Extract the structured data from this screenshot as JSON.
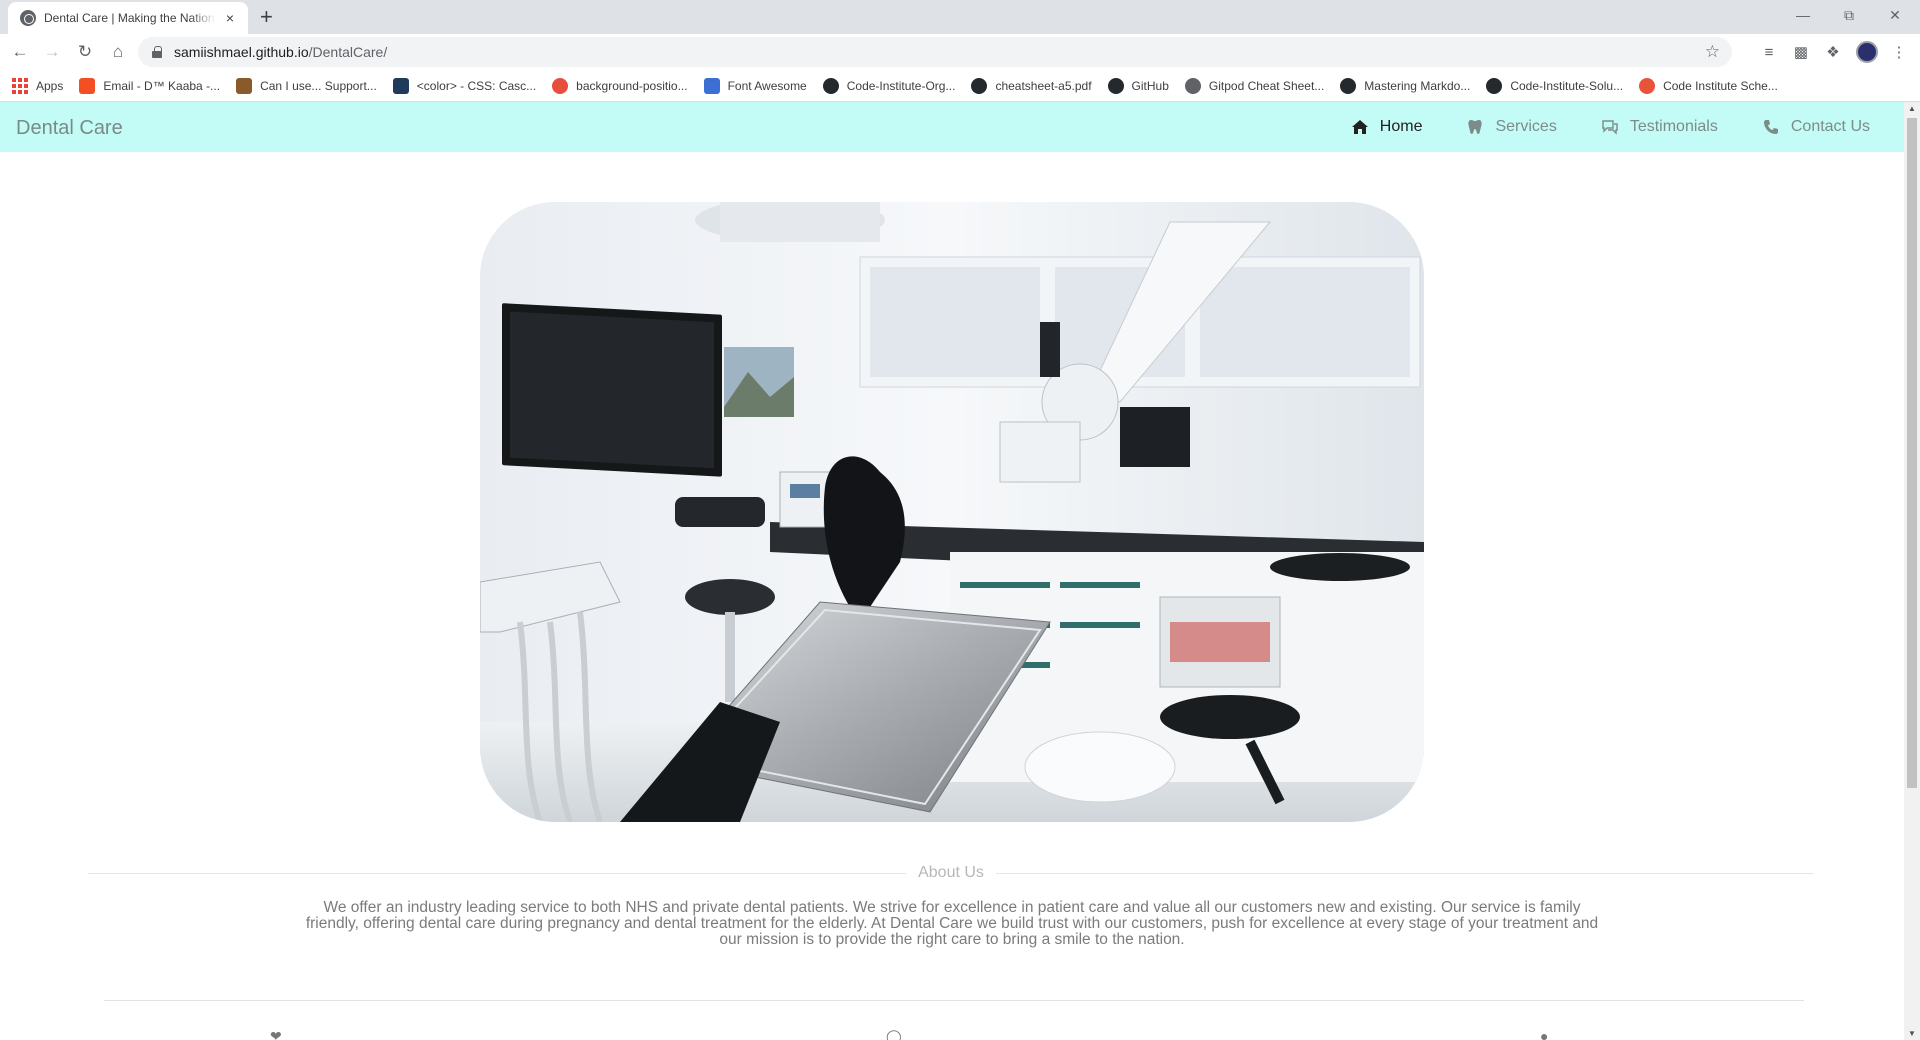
{
  "browser": {
    "tab_title": "Dental Care | Making the Nation",
    "tab_close": "×",
    "new_tab": "+",
    "url_host": "samiishmael.github.io",
    "url_path": "/DentalCare/",
    "bookmarks": [
      {
        "label": "Apps",
        "icon": "apps-grid",
        "color": "#ea4335"
      },
      {
        "label": "Email - D™ Kaaba -...",
        "icon": "office-icon",
        "color": "#f25022"
      },
      {
        "label": "Can I use... Support...",
        "icon": "caniuse-icon",
        "color": "#8b5a2b"
      },
      {
        "label": "<color> - CSS: Casc...",
        "icon": "mdn-icon",
        "color": "#1f3a5a"
      },
      {
        "label": "background-positio...",
        "icon": "css-icon",
        "color": "#e84e3d"
      },
      {
        "label": "Font Awesome",
        "icon": "flag-icon",
        "color": "#3b6fd4"
      },
      {
        "label": "Code-Institute-Org...",
        "icon": "github-icon",
        "color": "#24292e"
      },
      {
        "label": "cheatsheet-a5.pdf",
        "icon": "github-icon",
        "color": "#24292e"
      },
      {
        "label": "GitHub",
        "icon": "github-icon",
        "color": "#24292e"
      },
      {
        "label": "Gitpod Cheat Sheet...",
        "icon": "globe-icon",
        "color": "#5f6368"
      },
      {
        "label": "Mastering Markdo...",
        "icon": "github-icon",
        "color": "#24292e"
      },
      {
        "label": "Code-Institute-Solu...",
        "icon": "github-icon",
        "color": "#24292e"
      },
      {
        "label": "Code Institute Sche...",
        "icon": "ci-icon",
        "color": "#e8543a"
      }
    ]
  },
  "site": {
    "brand": "Dental Care",
    "nav": [
      {
        "label": "Home",
        "icon": "home-icon",
        "active": true
      },
      {
        "label": "Services",
        "icon": "tooth-icon",
        "active": false
      },
      {
        "label": "Testimonials",
        "icon": "comments-icon",
        "active": false
      },
      {
        "label": "Contact Us",
        "icon": "phone-icon",
        "active": false
      }
    ],
    "about_heading": "About Us",
    "about_text": "We offer an industry leading service to both NHS and private dental patients. We strive for excellence in patient care and value all our customers new and existing. Our service is family friendly, offering dental care during pregnancy and dental treatment for the elderly. At Dental Care we build trust with our customers, push for excellence at every stage of your treatment and our mission is to provide the right care to bring a smile to the nation."
  },
  "colors": {
    "navbar_bg": "#c3fcf6",
    "brand_text": "#7a8a88",
    "nav_active": "#222222"
  }
}
